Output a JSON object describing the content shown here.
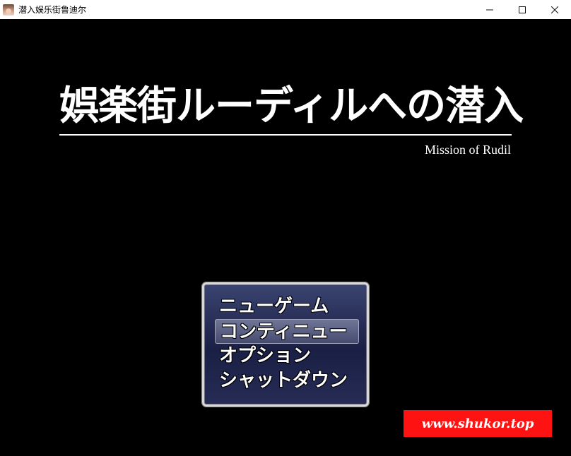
{
  "window": {
    "title": "潜入娱乐街鲁迪尔",
    "controls": {
      "minimize_icon": "minimize-icon",
      "maximize_icon": "maximize-icon",
      "close_icon": "close-icon"
    }
  },
  "game": {
    "title": "娯楽街ルーディルへの潜入",
    "subtitle": "Mission of Rudil",
    "menu": {
      "items": [
        {
          "label": "ニューゲーム",
          "selected": false
        },
        {
          "label": "コンティニュー",
          "selected": true
        },
        {
          "label": "オプション",
          "selected": false
        },
        {
          "label": "シャットダウン",
          "selected": false
        }
      ]
    },
    "watermark": "www.shukor.top"
  },
  "colors": {
    "background": "#000000",
    "menu_window": "#1a1f45",
    "watermark_bg": "#ff1212",
    "text": "#ffffff"
  }
}
